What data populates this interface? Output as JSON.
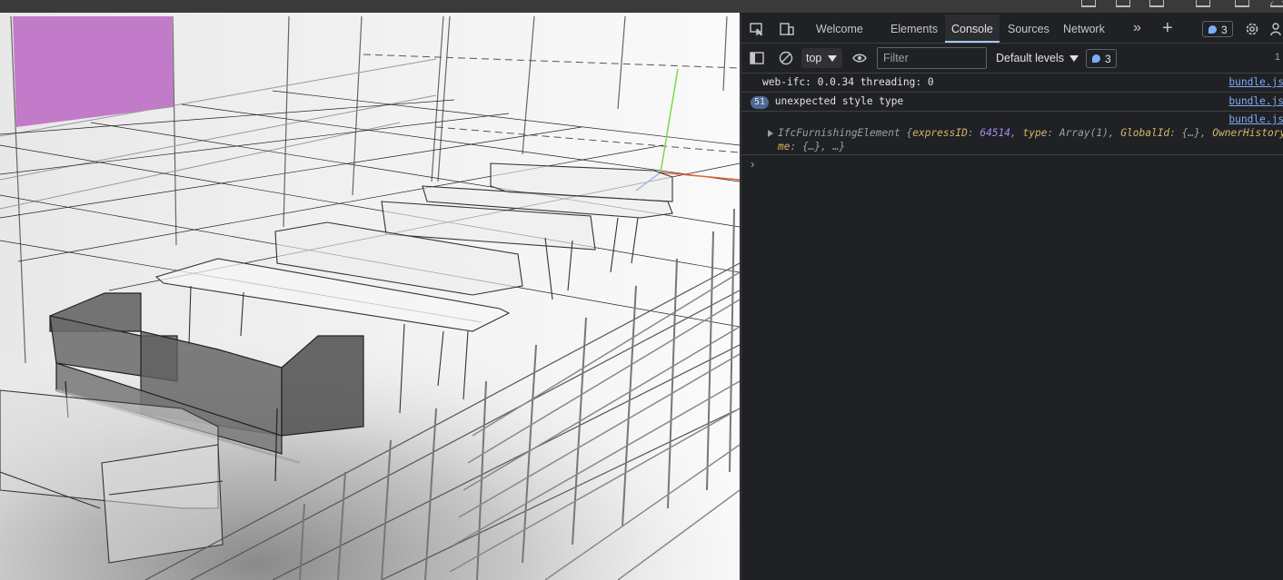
{
  "devtools": {
    "tabs": [
      {
        "label": "Welcome",
        "active": false
      },
      {
        "label": "Elements",
        "active": false
      },
      {
        "label": "Console",
        "active": true
      },
      {
        "label": "Sources",
        "active": false
      },
      {
        "label": "Network",
        "active": false
      }
    ],
    "issues_count": "3",
    "toolbar": {
      "context": "top",
      "filter_placeholder": "Filter",
      "levels": "Default levels",
      "issues_count": "3",
      "right_text": "1"
    },
    "console": {
      "messages": [
        {
          "text": "web-ifc: 0.0.34 threading: 0",
          "source": "bundle.js"
        },
        {
          "count": "51",
          "text": "unexpected style type",
          "source": "bundle.js"
        },
        {
          "source": "bundle.js",
          "object_name": "IfcFurnishingElement",
          "line1_parts": [
            {
              "t": "{",
              "c": "obj"
            },
            {
              "t": "expressID",
              "c": "k"
            },
            {
              "t": ": ",
              "c": "obj"
            },
            {
              "t": "64514",
              "c": "num"
            },
            {
              "t": ", ",
              "c": "obj"
            },
            {
              "t": "type",
              "c": "k"
            },
            {
              "t": ": Array(1), ",
              "c": "obj"
            },
            {
              "t": "GlobalId",
              "c": "k"
            },
            {
              "t": ": {…}, ",
              "c": "obj"
            },
            {
              "t": "OwnerHistory",
              "c": "k"
            },
            {
              "t": ":",
              "c": "obj"
            }
          ],
          "line2_parts": [
            {
              "t": "me",
              "c": "k"
            },
            {
              "t": ": {…}, …}",
              "c": "obj"
            }
          ]
        }
      ],
      "prompt": "›"
    }
  },
  "viewport": {
    "accent_color": "#c27bc8",
    "axes_colors": {
      "y": "#7cd84a",
      "x": "#e0643a",
      "z": "#3a6ae0"
    }
  }
}
